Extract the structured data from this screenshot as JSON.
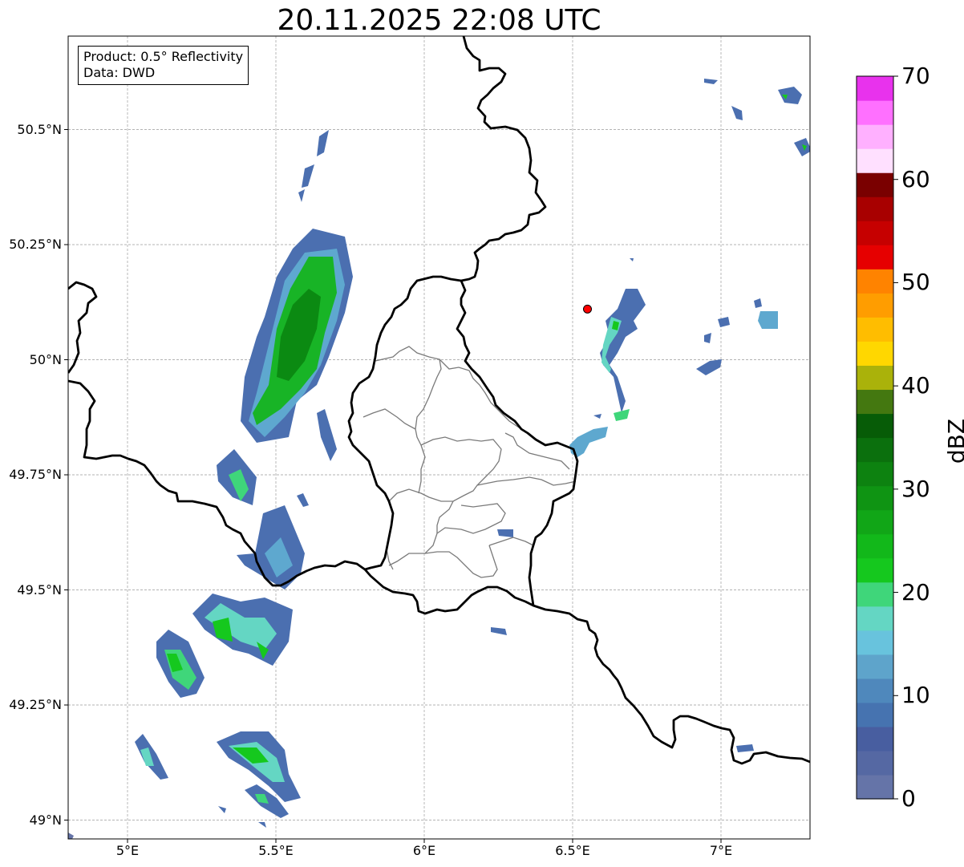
{
  "title": "20.11.2025 22:08 UTC",
  "info": {
    "line1": "Product: 0.5° Reflectivity",
    "line2": "Data: DWD"
  },
  "map": {
    "lon_range": [
      4.8,
      7.3
    ],
    "lat_range": [
      48.95,
      50.7
    ],
    "y_ticks": [
      {
        "lat": 50.5,
        "label": "50.5°N"
      },
      {
        "lat": 50.25,
        "label": "50.25°N"
      },
      {
        "lat": 50.0,
        "label": "50°N"
      },
      {
        "lat": 49.75,
        "label": "49.75°N"
      },
      {
        "lat": 49.5,
        "label": "49.5°N"
      },
      {
        "lat": 49.25,
        "label": "49.25°N"
      },
      {
        "lat": 49.0,
        "label": "49°N"
      }
    ],
    "x_ticks": [
      {
        "lon": 5.0,
        "label": "5°E"
      },
      {
        "lon": 5.5,
        "label": "5.5°E"
      },
      {
        "lon": 6.0,
        "label": "6°E"
      },
      {
        "lon": 6.5,
        "label": "6.5°E"
      },
      {
        "lon": 7.0,
        "label": "7°E"
      }
    ],
    "gridlines": true,
    "radar_site": {
      "lon": 6.55,
      "lat": 50.11,
      "color": "#ff0000"
    }
  },
  "colorbar": {
    "label": "dBZ",
    "min": 0,
    "max": 70,
    "ticks": [
      "0",
      "10",
      "20",
      "30",
      "40",
      "50",
      "60",
      "70"
    ],
    "colors": [
      "#6574a8",
      "#5568a3",
      "#485ea0",
      "#4673b0",
      "#4f88bc",
      "#5ea4cb",
      "#68c3dd",
      "#64d6c3",
      "#3fd67a",
      "#15c81e",
      "#12b81a",
      "#11a617",
      "#0f9413",
      "#0d8210",
      "#0b700d",
      "#075c07",
      "#447810",
      "#aab20a",
      "#ffd700",
      "#ffbd00",
      "#ff9d00",
      "#ff8300",
      "#e60000",
      "#c60000",
      "#a80000",
      "#7a0000",
      "#ffe0ff",
      "#ffb0ff",
      "#ff70ff",
      "#e832ed"
    ]
  }
}
